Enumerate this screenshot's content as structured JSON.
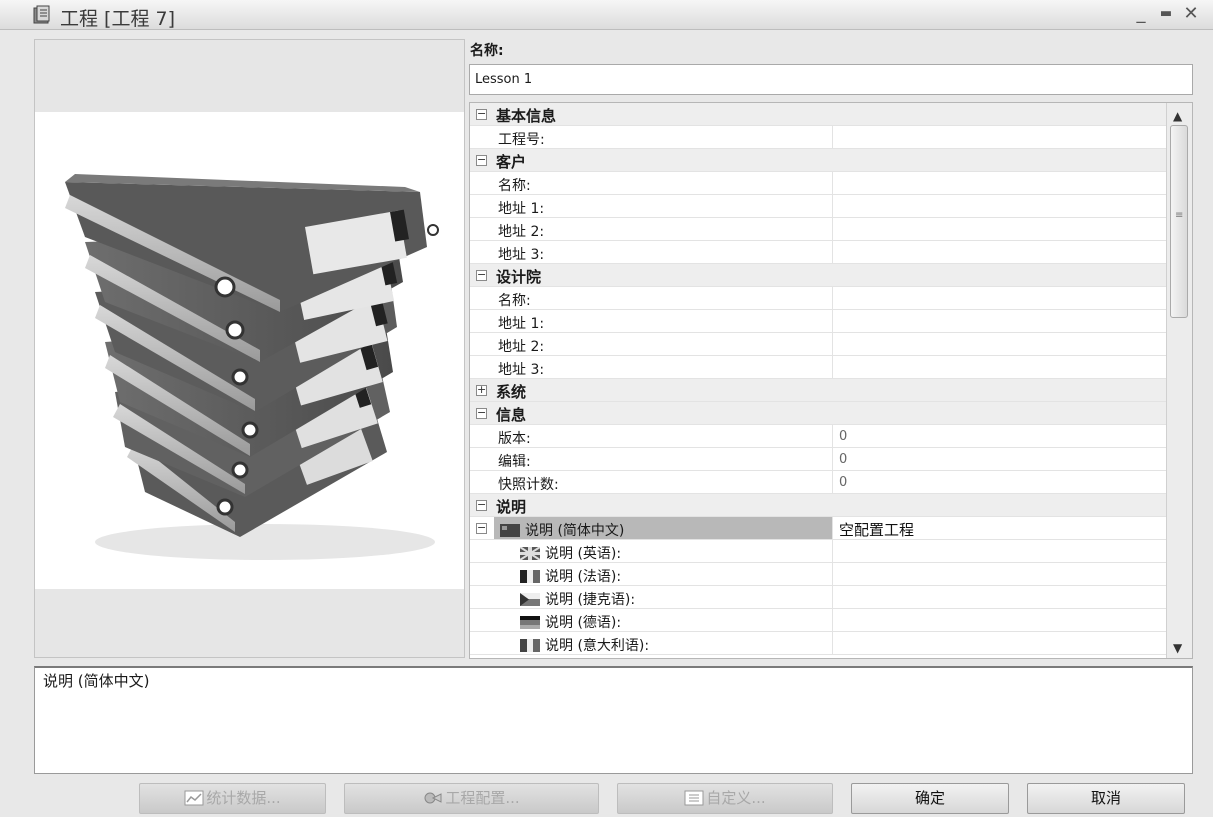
{
  "window": {
    "title": "工程 [工程 7]",
    "controls": {
      "minimize": "_",
      "maximize": "▬",
      "close": "✕"
    }
  },
  "name_field": {
    "label": "名称:",
    "value": "Lesson 1"
  },
  "grid": {
    "rows": [
      {
        "kind": "cat",
        "toggle": "−",
        "label": "基本信息",
        "value": ""
      },
      {
        "kind": "prop",
        "label": "工程号:",
        "value": ""
      },
      {
        "kind": "cat",
        "toggle": "−",
        "label": "客户",
        "value": ""
      },
      {
        "kind": "prop",
        "label": "名称:",
        "value": ""
      },
      {
        "kind": "prop",
        "label": "地址 1:",
        "value": ""
      },
      {
        "kind": "prop",
        "label": "地址 2:",
        "value": ""
      },
      {
        "kind": "prop",
        "label": "地址 3:",
        "value": ""
      },
      {
        "kind": "cat",
        "toggle": "−",
        "label": "设计院",
        "value": ""
      },
      {
        "kind": "prop",
        "label": "名称:",
        "value": ""
      },
      {
        "kind": "prop",
        "label": "地址 1:",
        "value": ""
      },
      {
        "kind": "prop",
        "label": "地址 2:",
        "value": ""
      },
      {
        "kind": "prop",
        "label": "地址 3:",
        "value": ""
      },
      {
        "kind": "cat",
        "toggle": "+",
        "label": "系统",
        "value": ""
      },
      {
        "kind": "cat",
        "toggle": "−",
        "label": "信息",
        "value": ""
      },
      {
        "kind": "prop",
        "label": "版本:",
        "value": "0"
      },
      {
        "kind": "prop",
        "label": "编辑:",
        "value": "0"
      },
      {
        "kind": "prop",
        "label": "快照计数:",
        "value": "0"
      },
      {
        "kind": "cat",
        "toggle": "−",
        "label": "说明",
        "value": ""
      },
      {
        "kind": "sel",
        "toggle": "−",
        "label": "说明 (简体中文)",
        "value": "空配置工程",
        "flag": "china-flag-icon"
      },
      {
        "kind": "sub",
        "label": "说明 (英语):",
        "value": "",
        "flag": "uk-flag-icon"
      },
      {
        "kind": "sub",
        "label": "说明 (法语):",
        "value": "",
        "flag": "france-flag-icon"
      },
      {
        "kind": "sub",
        "label": "说明 (捷克语):",
        "value": "",
        "flag": "czech-flag-icon"
      },
      {
        "kind": "sub",
        "label": "说明 (德语):",
        "value": "",
        "flag": "germany-flag-icon"
      },
      {
        "kind": "sub",
        "label": "说明 (意大利语):",
        "value": "",
        "flag": "italy-flag-icon"
      }
    ]
  },
  "description_box": {
    "text": "说明 (简体中文)"
  },
  "buttons": {
    "stats": "统计数据...",
    "project_config": "工程配置...",
    "customize": "自定义...",
    "ok": "确定",
    "cancel": "取消"
  },
  "icons": {
    "title": "project-icon",
    "stats": "chart-icon",
    "project_config": "config-icon",
    "customize": "customize-icon"
  }
}
